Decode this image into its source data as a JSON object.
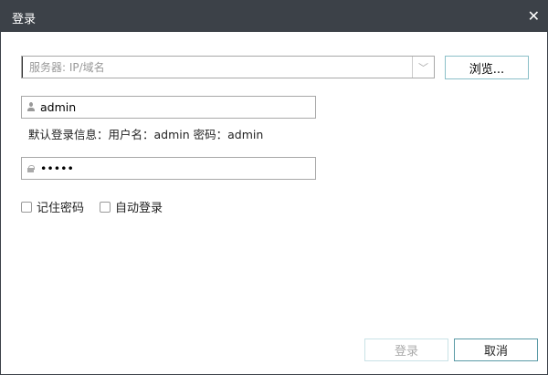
{
  "window": {
    "title": "登录",
    "close_glyph": "✕"
  },
  "server": {
    "placeholder": "服务器: IP/域名",
    "dropdown_glyph": "﹀",
    "browse_label": "浏览..."
  },
  "username": {
    "value": "admin"
  },
  "hint": "默认登录信息：用户名：admin 密码：admin",
  "password": {
    "value": "admin"
  },
  "options": {
    "remember": "记住密码",
    "auto_login": "自动登录"
  },
  "buttons": {
    "login": "登录",
    "cancel": "取消"
  }
}
